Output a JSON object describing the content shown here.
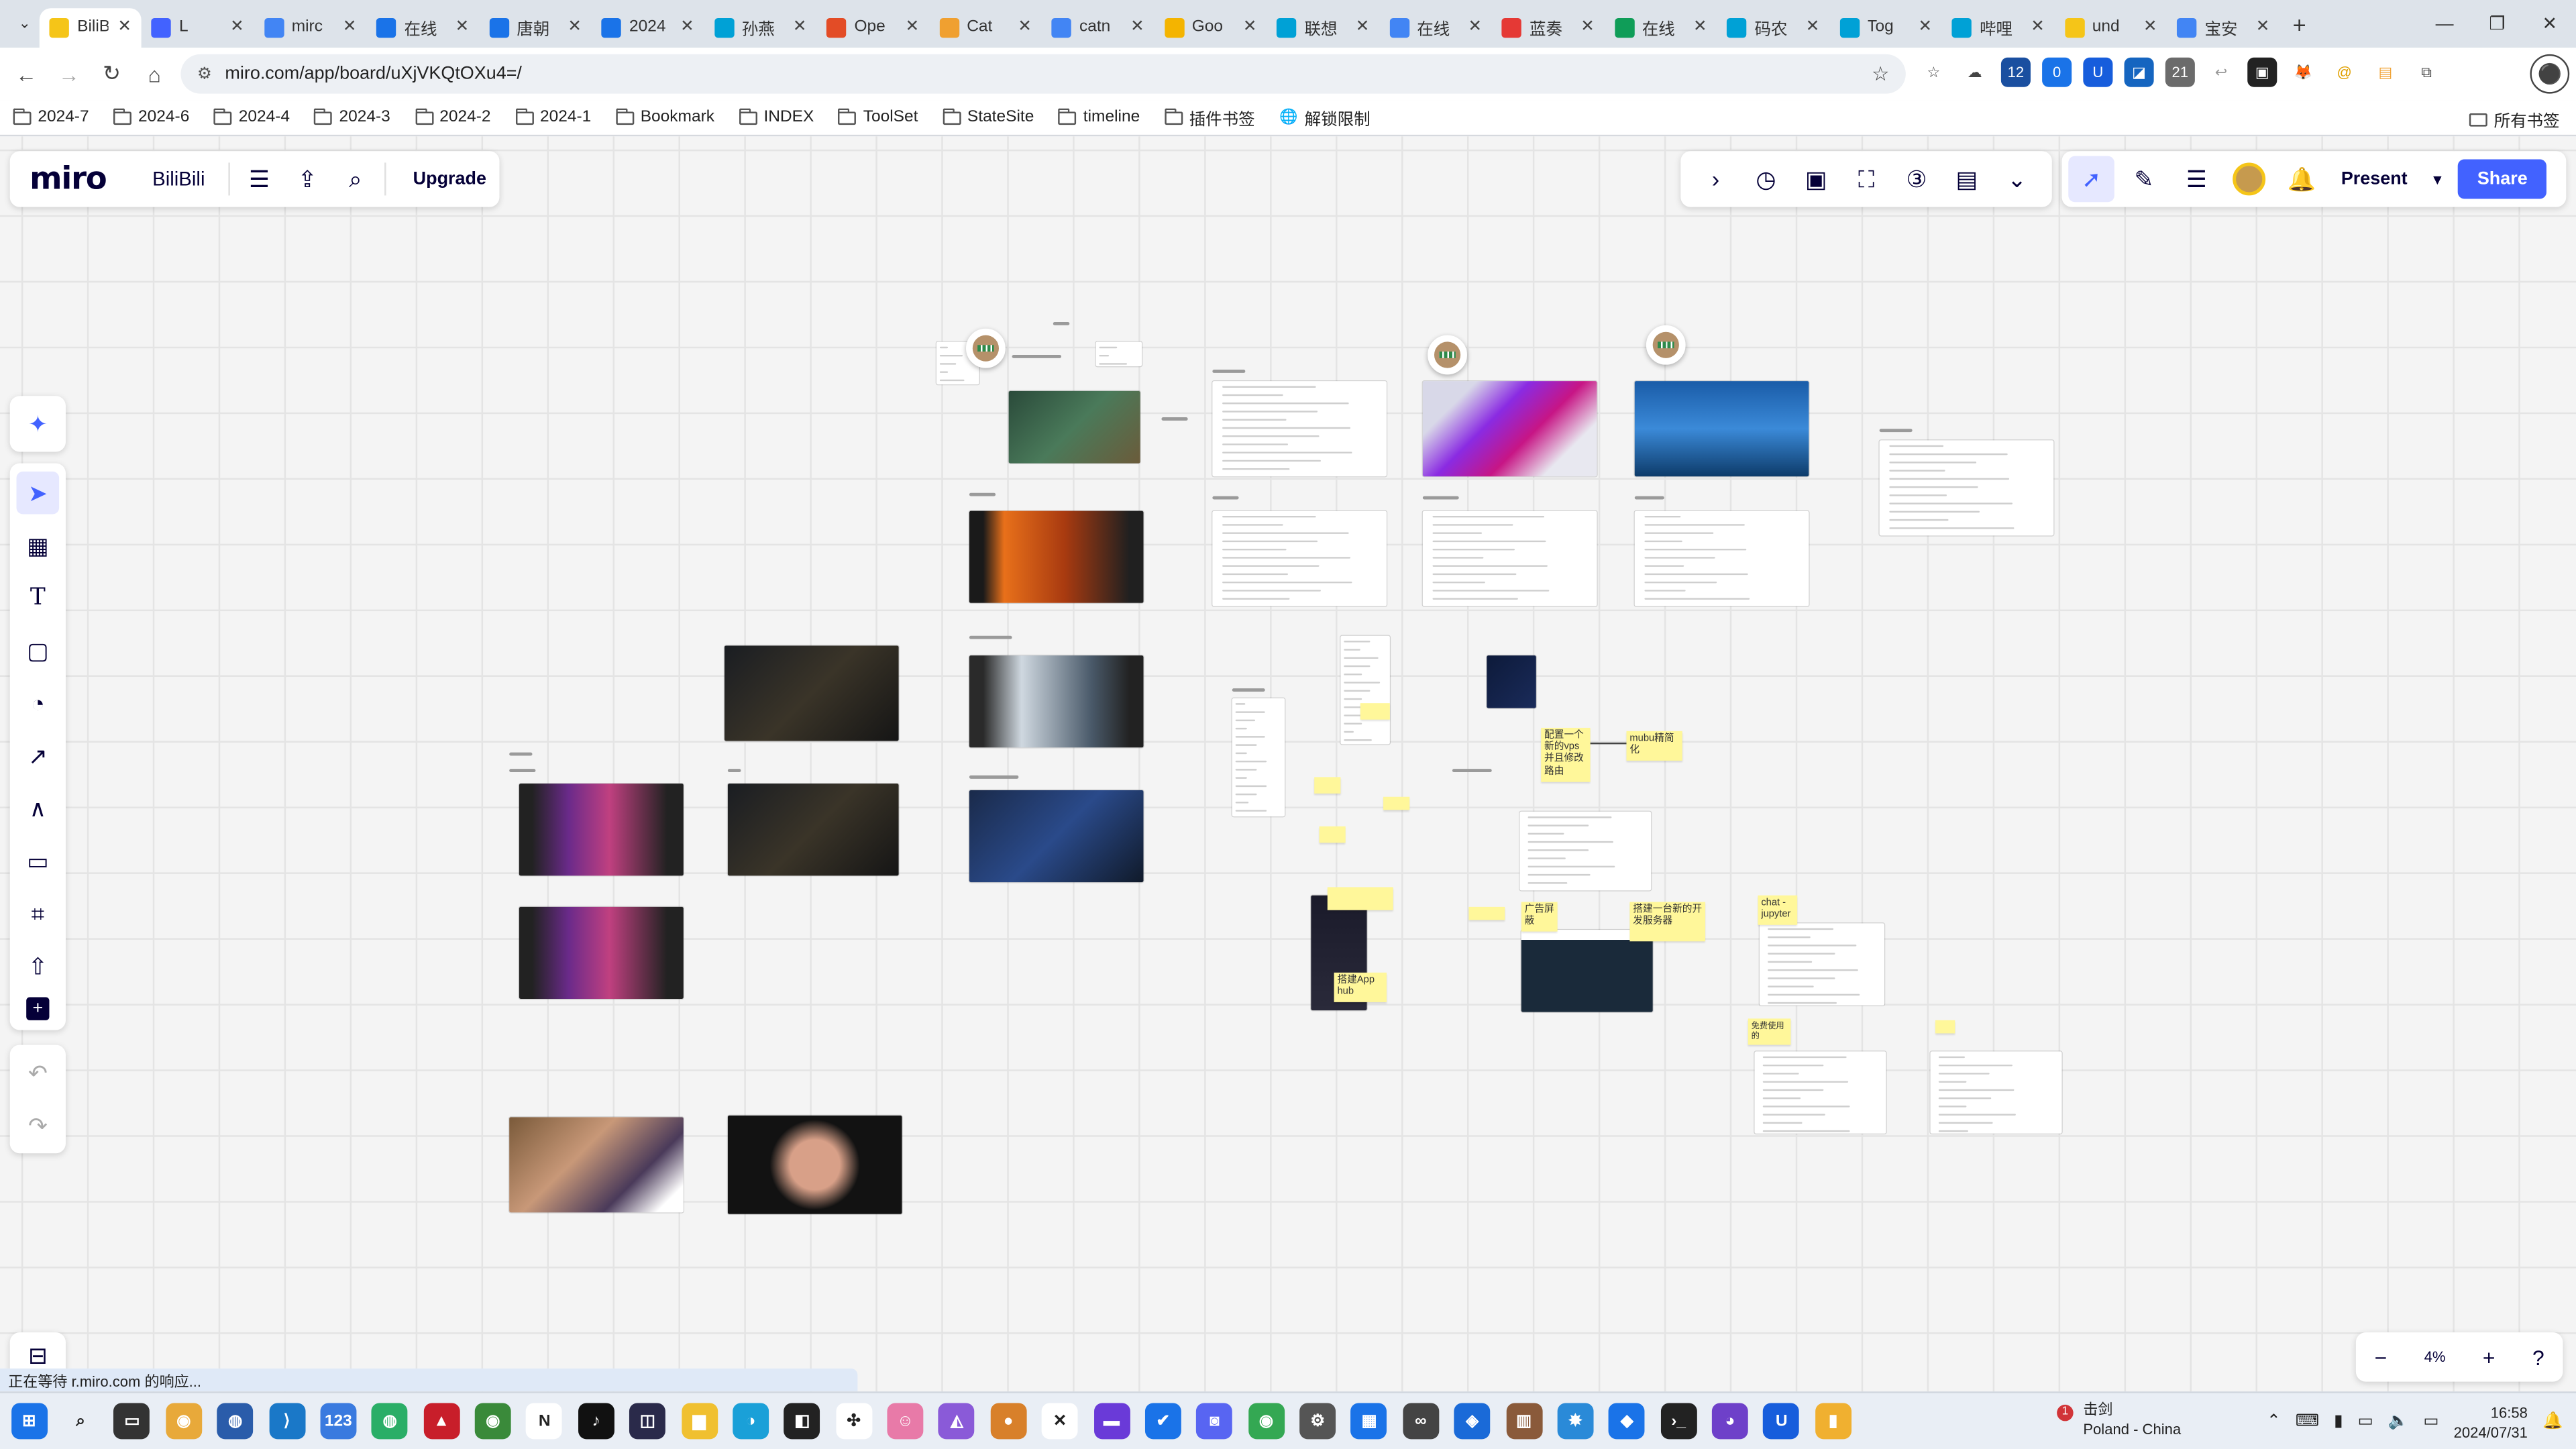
{
  "browser": {
    "tabs": [
      {
        "label": "BiliBi",
        "color": "#f5c518",
        "active": true
      },
      {
        "label": "L",
        "color": "#4262ff"
      },
      {
        "label": "mirc",
        "color": "#4285f4"
      },
      {
        "label": "在线",
        "color": "#1a73e8"
      },
      {
        "label": "唐朝",
        "color": "#1a73e8"
      },
      {
        "label": "2024",
        "color": "#1a73e8"
      },
      {
        "label": "孙燕",
        "color": "#00a1d6"
      },
      {
        "label": "Ope",
        "color": "#e34c26"
      },
      {
        "label": "Cat",
        "color": "#f0a030"
      },
      {
        "label": "catn",
        "color": "#4285f4"
      },
      {
        "label": "Goo",
        "color": "#f4b400"
      },
      {
        "label": "联想",
        "color": "#00a1d6"
      },
      {
        "label": "在线",
        "color": "#4285f4"
      },
      {
        "label": "蓝奏",
        "color": "#e53935"
      },
      {
        "label": "在线",
        "color": "#0f9d58"
      },
      {
        "label": "码农",
        "color": "#00a1d6"
      },
      {
        "label": "Tog",
        "color": "#00a1d6"
      },
      {
        "label": "哔哩",
        "color": "#00a1d6"
      },
      {
        "label": "und",
        "color": "#f5c518"
      },
      {
        "label": "宝安",
        "color": "#4285f4"
      }
    ],
    "url": "miro.com/app/board/uXjVKQtOXu4=/",
    "bookmarks": [
      "2024-7",
      "2024-6",
      "2024-4",
      "2024-3",
      "2024-2",
      "2024-1",
      "Bookmark",
      "INDEX",
      "ToolSet",
      "StateSite",
      "timeline",
      "插件书签",
      "解锁限制"
    ],
    "all_bookmarks": "所有书签",
    "extensions": [
      {
        "name": "star-outline-icon",
        "color": "#ffffff",
        "glyph": "☆",
        "fg": "#444"
      },
      {
        "name": "cloud-icon",
        "color": "#ffffff",
        "glyph": "☁",
        "fg": "#444"
      },
      {
        "name": "ext-12-icon",
        "color": "#1a4fa0",
        "glyph": "12",
        "fg": "#fff"
      },
      {
        "name": "ext-0-icon",
        "color": "#1a73e8",
        "glyph": "0",
        "fg": "#fff"
      },
      {
        "name": "bitwarden-icon",
        "color": "#175ddc",
        "glyph": "U",
        "fg": "#fff"
      },
      {
        "name": "ext-blue-icon",
        "color": "#1565c0",
        "glyph": "◪",
        "fg": "#fff"
      },
      {
        "name": "ext-21-icon",
        "color": "#6b6b6b",
        "glyph": "21",
        "fg": "#fff"
      },
      {
        "name": "reply-icon",
        "color": "#ffffff",
        "glyph": "↩",
        "fg": "#999"
      },
      {
        "name": "ext-black-icon",
        "color": "#222222",
        "glyph": "▣",
        "fg": "#fff"
      },
      {
        "name": "metamask-icon",
        "color": "#ffffff",
        "glyph": "🦊",
        "fg": "#e2761b"
      },
      {
        "name": "ext-yellow-icon",
        "color": "#ffffff",
        "glyph": "@",
        "fg": "#e0a000"
      },
      {
        "name": "ext-note-icon",
        "color": "#ffffff",
        "glyph": "▤",
        "fg": "#f0a030"
      },
      {
        "name": "puzzle-icon",
        "color": "#ffffff",
        "glyph": "⧉",
        "fg": "#444"
      }
    ]
  },
  "miro": {
    "board_name": "BiliBili",
    "upgrade": "Upgrade",
    "present": "Present",
    "share": "Share",
    "zoom": "4%",
    "accent": "#4262ff"
  },
  "canvas": {
    "stickies": [
      "配置一个新的vps并且修改路由",
      "mubu精简化",
      "广告屏蔽",
      "搭建一台新的开发服务器",
      "chat - jupyter",
      "搭建App hub",
      "免费使用的"
    ]
  },
  "status_text": "正在等待 r.miro.com 的响应...",
  "weather": {
    "temp": "击剑",
    "location": "Poland - China",
    "badge": "1"
  },
  "clock": {
    "time": "16:58",
    "date": "2024/07/31"
  }
}
